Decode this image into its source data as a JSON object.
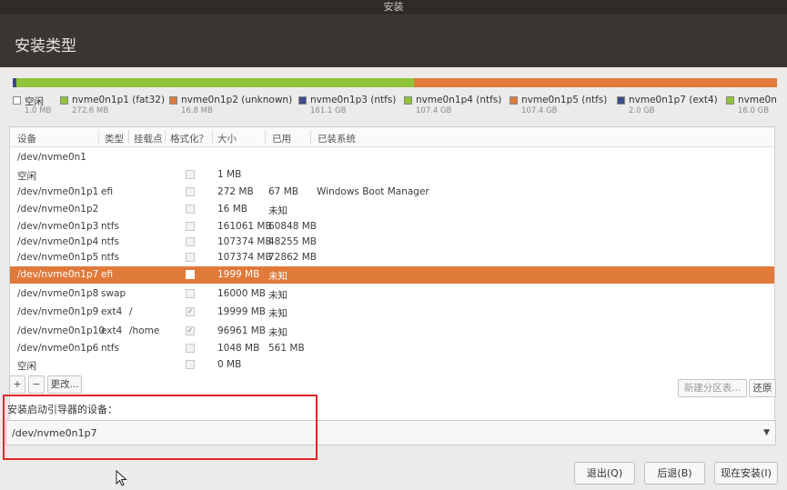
{
  "window": {
    "title": "安装"
  },
  "header": {
    "title": "安装类型"
  },
  "partition_bar": [
    {
      "color": "#3f4b8a",
      "fraction": 0.005
    },
    {
      "color": "#8fc33a",
      "fraction": 0.52
    },
    {
      "color": "#e07a3a",
      "fraction": 0.475
    }
  ],
  "legend": [
    {
      "name": "空闲",
      "size": "1.0 MB",
      "color": "#ffffff"
    },
    {
      "name": "nvme0n1p1 (fat32)",
      "size": "272.6 MB",
      "color": "#8fc33a"
    },
    {
      "name": "nvme0n1p2 (unknown)",
      "size": "16.8 MB",
      "color": "#e07a3a"
    },
    {
      "name": "nvme0n1p3 (ntfs)",
      "size": "161.1 GB",
      "color": "#3f4b8a"
    },
    {
      "name": "nvme0n1p4 (ntfs)",
      "size": "107.4 GB",
      "color": "#8fc33a"
    },
    {
      "name": "nvme0n1p5 (ntfs)",
      "size": "107.4 GB",
      "color": "#e07a3a"
    },
    {
      "name": "nvme0n1p7 (ext4)",
      "size": "2.0 GB",
      "color": "#3f4b8a"
    },
    {
      "name": "nvme0n",
      "size": "16.0 GB",
      "color": "#8fc33a"
    }
  ],
  "table": {
    "headers": [
      "设备",
      "类型",
      "挂载点",
      "格式化？",
      "大小",
      "已用",
      "已装系统"
    ],
    "rows": [
      {
        "device": "/dev/nvme0n1",
        "type": "",
        "mount": "",
        "format": "none",
        "size": "",
        "used": "",
        "system": ""
      },
      {
        "device": "空闲",
        "type": "",
        "mount": "",
        "format": "empty",
        "size": "1 MB",
        "used": "",
        "system": ""
      },
      {
        "device": "/dev/nvme0n1p1",
        "type": "efi",
        "mount": "",
        "format": "empty",
        "size": "272 MB",
        "used": "67 MB",
        "system": "Windows Boot Manager"
      },
      {
        "device": "/dev/nvme0n1p2",
        "type": "",
        "mount": "",
        "format": "empty",
        "size": "16 MB",
        "used": "未知",
        "system": ""
      },
      {
        "device": "/dev/nvme0n1p3",
        "type": "ntfs",
        "mount": "",
        "format": "empty",
        "size": "161061 MB",
        "used": "60848 MB",
        "system": ""
      },
      {
        "device": "/dev/nvme0n1p4",
        "type": "ntfs",
        "mount": "",
        "format": "empty",
        "size": "107374 MB",
        "used": "48255 MB",
        "system": ""
      },
      {
        "device": "/dev/nvme0n1p5",
        "type": "ntfs",
        "mount": "",
        "format": "empty",
        "size": "107374 MB",
        "used": "72862 MB",
        "system": ""
      },
      {
        "device": "/dev/nvme0n1p7",
        "type": "efi",
        "mount": "",
        "format": "empty",
        "size": "1999 MB",
        "used": "未知",
        "system": "",
        "selected": true
      },
      {
        "device": "/dev/nvme0n1p8",
        "type": "swap",
        "mount": "",
        "format": "empty",
        "size": "16000 MB",
        "used": "未知",
        "system": ""
      },
      {
        "device": "/dev/nvme0n1p9",
        "type": "ext4",
        "mount": "/",
        "format": "checked",
        "size": "19999 MB",
        "used": "未知",
        "system": ""
      },
      {
        "device": "/dev/nvme0n1p10",
        "type": "ext4",
        "mount": "/home",
        "format": "checked",
        "size": "96961 MB",
        "used": "未知",
        "system": ""
      },
      {
        "device": "/dev/nvme0n1p6",
        "type": "ntfs",
        "mount": "",
        "format": "empty",
        "size": "1048 MB",
        "used": "561 MB",
        "system": ""
      },
      {
        "device": "空闲",
        "type": "",
        "mount": "",
        "format": "empty",
        "size": "0 MB",
        "used": "",
        "system": ""
      }
    ]
  },
  "toolbar": {
    "add_label": "+",
    "remove_label": "−",
    "change_label": "更改...",
    "new_table_label": "新建分区表...",
    "revert_label": "还原"
  },
  "boot": {
    "label": "安装启动引导器的设备：",
    "value": "/dev/nvme0n1p7"
  },
  "buttons": {
    "quit": "退出(Q)",
    "back": "后退(B)",
    "install": "现在安装(I)"
  }
}
